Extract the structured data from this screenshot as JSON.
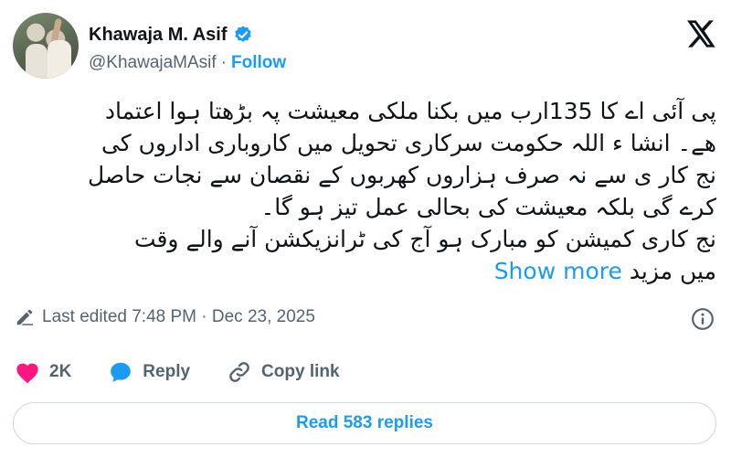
{
  "author": {
    "display_name": "Khawaja M. Asif",
    "handle": "@KhawajaMAsif",
    "separator": "·",
    "follow_label": "Follow"
  },
  "tweet": {
    "lines": [
      "پی آئی اے کا 135ارب میں بکنا ملکی معیشت پہ بڑھتا ہوا اعتماد",
      "ھے۔ انشا ء اللہ حکومت سرکاری تحویل میں کاروباری اداروں  کی",
      "نج کار ی سے نہ صرف ہزاروں کھربوں کے نقصان سے نجات حاصل",
      "کرے گی بلکہ معیشت کی بحالی عمل تیز ہو گا۔",
      "نج کاری کمیشن کو مبارک ہو آج کی ٹرانزیکشن  آنے والے وقت",
      "میں مزید"
    ],
    "show_more_label": "Show more"
  },
  "meta": {
    "edited_text": "Last edited 7:48 PM · Dec 23, 2025"
  },
  "actions": {
    "likes_count": "2K",
    "reply_label": "Reply",
    "copy_link_label": "Copy link"
  },
  "footer": {
    "read_replies_label": "Read 583 replies"
  },
  "colors": {
    "accent": "#1d9bf0",
    "like": "#f91880",
    "muted": "#536471"
  },
  "icons": [
    "verified-badge-icon",
    "x-logo-icon",
    "edit-pencil-icon",
    "info-icon",
    "heart-icon",
    "reply-bubble-icon",
    "link-icon"
  ]
}
